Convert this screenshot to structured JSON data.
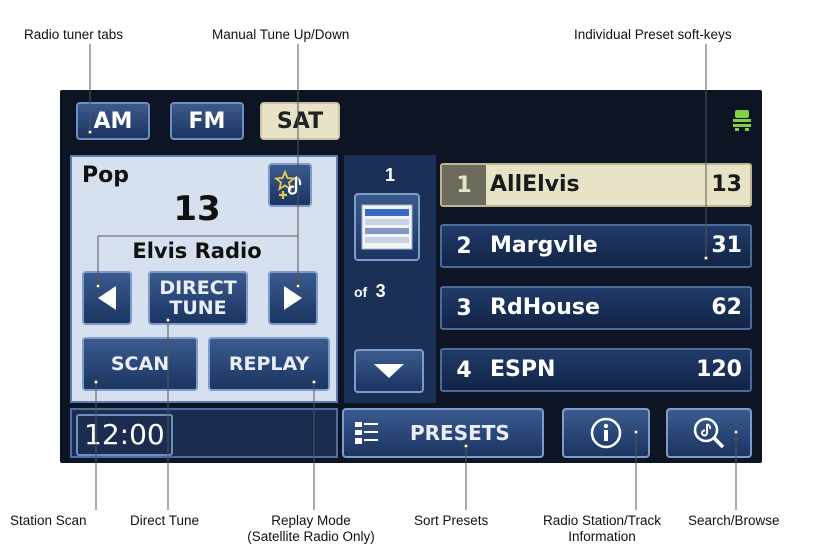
{
  "callouts": {
    "radio_tuner_tabs": "Radio tuner tabs",
    "manual_tune": "Manual Tune Up/Down",
    "individual_presets": "Individual Preset soft-keys",
    "station_scan": "Station Scan",
    "direct_tune": "Direct Tune",
    "replay_mode_line1": "Replay Mode",
    "replay_mode_line2": "(Satellite Radio Only)",
    "sort_presets": "Sort Presets",
    "station_info_line1": "Radio Station/Track",
    "station_info_line2": "Information",
    "search_browse": "Search/Browse"
  },
  "tabs": [
    {
      "label": "AM",
      "active": false
    },
    {
      "label": "FM",
      "active": false
    },
    {
      "label": "SAT",
      "active": true
    }
  ],
  "now_playing": {
    "category": "Pop",
    "channel": "13",
    "station_name": "Elvis Radio"
  },
  "buttons": {
    "direct_tune_line1": "DIRECT",
    "direct_tune_line2": "TUNE",
    "scan": "SCAN",
    "replay": "REPLAY",
    "presets": "PRESETS"
  },
  "preset_page": {
    "current": "1",
    "of_label": "of",
    "total": "3"
  },
  "presets": [
    {
      "num": "1",
      "name": "AllElvis",
      "channel": "13",
      "selected": true
    },
    {
      "num": "2",
      "name": "Margvlle",
      "channel": "31",
      "selected": false
    },
    {
      "num": "3",
      "name": "RdHouse",
      "channel": "62",
      "selected": false
    },
    {
      "num": "4",
      "name": "ESPN",
      "channel": "120",
      "selected": false
    }
  ],
  "clock": "12:00",
  "icons": {
    "favorite": "star-music-add-icon",
    "prev": "left-arrow-icon",
    "next": "right-arrow-icon",
    "page_down": "down-arrow-icon",
    "preset_list": "preset-list-icon",
    "sort": "sort-list-icon",
    "info": "info-icon",
    "search": "music-search-icon",
    "status": "vehicle-status-icon"
  },
  "colors": {
    "screen_bg": "#0d1524",
    "button_blue": "#1c3562",
    "active_tab": "#e8e3c8",
    "status_green": "#7fd14a"
  }
}
